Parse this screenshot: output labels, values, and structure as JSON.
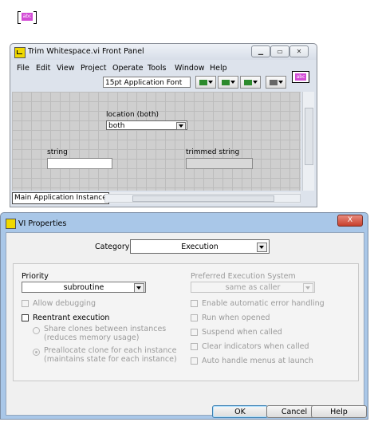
{
  "top_icon": {
    "text": "abc"
  },
  "front_panel": {
    "title": "Trim Whitespace.vi Front Panel",
    "window_buttons": [
      "▁",
      "▭",
      "✕"
    ],
    "menus": [
      "File",
      "Edit",
      "View",
      "Project",
      "Operate",
      "Tools",
      "Window",
      "Help"
    ],
    "font_select": "15pt Application Font",
    "controls": {
      "location_label": "location (both)",
      "location_value": "both",
      "string_label": "string",
      "trimmed_label": "trimmed string"
    },
    "instance": "Main Application Instance",
    "corner_icon_text": "abc"
  },
  "dialog": {
    "title": "VI Properties",
    "close_label": "X",
    "category_label": "Category",
    "category_value": "Execution",
    "priority_label": "Priority",
    "priority_value": "subroutine",
    "preferred_label": "Preferred Execution System",
    "preferred_value": "same as caller",
    "allow_debugging": "Allow debugging",
    "reentrant": "Reentrant execution",
    "share_clones_1": "Share clones between instances",
    "share_clones_2": "(reduces memory usage)",
    "prealloc_1": "Preallocate clone for each instance",
    "prealloc_2": "(maintains state for each instance)",
    "auto_error": "Enable automatic error handling",
    "run_opened": "Run when opened",
    "suspend_called": "Suspend when called",
    "clear_indicators": "Clear indicators when called",
    "auto_menus": "Auto handle menus at launch",
    "ok": "OK",
    "cancel": "Cancel",
    "help": "Help"
  }
}
